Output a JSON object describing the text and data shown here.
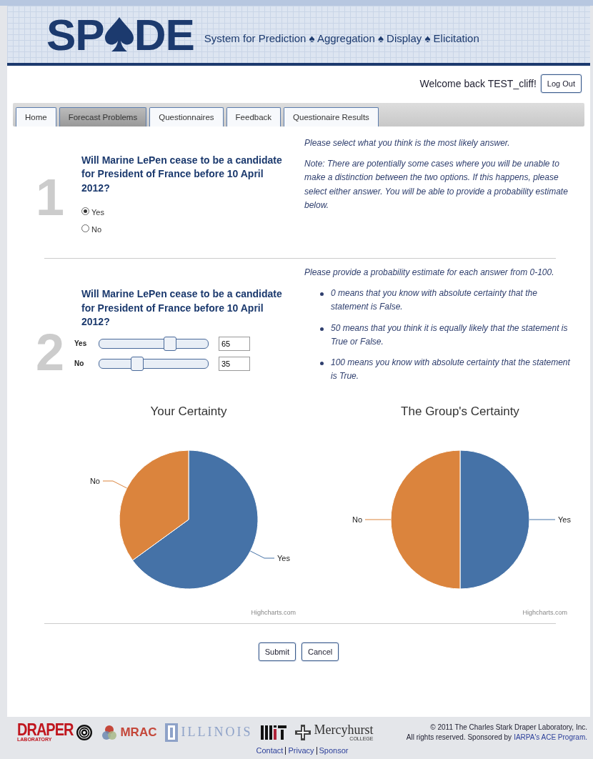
{
  "header": {
    "logo_start": "SP",
    "logo_end": "DE",
    "tagline": "System for Prediction ♠ Aggregation ♠ Display ♠ Elicitation"
  },
  "user_bar": {
    "welcome": "Welcome back TEST_cliff!",
    "logout": "Log Out"
  },
  "tabs": [
    {
      "label": "Home",
      "selected": false
    },
    {
      "label": "Forecast Problems",
      "selected": true
    },
    {
      "label": "Questionnaires",
      "selected": false
    },
    {
      "label": "Feedback",
      "selected": false
    },
    {
      "label": "Questionaire Results",
      "selected": false
    }
  ],
  "step1": {
    "number": "1",
    "question": "Will Marine LePen cease to be a candidate for President of France before 10 April 2012?",
    "options": [
      {
        "label": "Yes",
        "selected": true
      },
      {
        "label": "No",
        "selected": false
      }
    ],
    "instruction": "Please select what you think is the most likely answer.",
    "note": "Note: There are potentially some cases where you will be unable to make a distinction between the two options. If this happens, please select either answer.  You will be able to provide a probability estimate below."
  },
  "step2": {
    "number": "2",
    "question": "Will Marine LePen cease to be a candidate for President of France before 10 April 2012?",
    "sliders": [
      {
        "label": "Yes",
        "level": 0.65,
        "value": "65"
      },
      {
        "label": "No",
        "level": 0.35,
        "value": "35"
      }
    ],
    "instruction": "Please provide a probability estimate for each answer from 0-100.",
    "bullets": [
      "0 means that you know with absolute certainty that the statement is False.",
      "50 means that you think it is equally likely that the statement is True or False.",
      "100 means you know with absolute certainty that the statement is True."
    ]
  },
  "charts": [
    {
      "credit": "Highcharts.com",
      "chart_data": {
        "type": "pie",
        "title": "Your Certainty",
        "categories": [
          "Yes",
          "No"
        ],
        "values": [
          65,
          35
        ],
        "colors": [
          "#4572a7",
          "#db843d"
        ]
      }
    },
    {
      "credit": "Highcharts.com",
      "chart_data": {
        "type": "pie",
        "title": "The Group's Certainty",
        "categories": [
          "Yes",
          "No"
        ],
        "values": [
          50,
          50
        ],
        "colors": [
          "#4572a7",
          "#db843d"
        ]
      }
    }
  ],
  "buttons": [
    "Submit",
    "Cancel"
  ],
  "footer": {
    "logos": {
      "draper": "DRAPER",
      "draper_sub": "LABORATORY",
      "mrac": "MRAC",
      "illinois": "ILLINOIS",
      "mercyhurst": "Mercyhurst",
      "mercyhurst_sub": "COLLEGE"
    },
    "copyright": "© 2011 The Charles Stark Draper Laboratory, Inc.",
    "rights": "All rights reserved. Sponsored by",
    "sponsor_link": "IARPA's ACE Program.",
    "links": [
      "Contact",
      "Privacy",
      "Sponsor"
    ]
  }
}
